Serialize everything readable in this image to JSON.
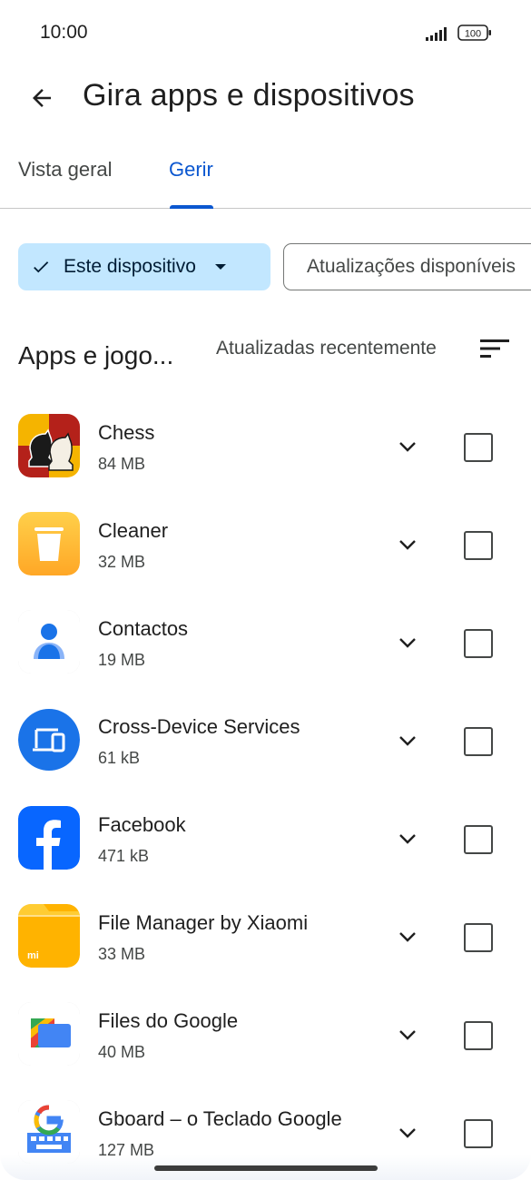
{
  "status_bar": {
    "time": "10:00",
    "battery": "100"
  },
  "header": {
    "back_icon": "arrow-back-icon",
    "title": "Gira apps e dispositivos"
  },
  "tabs": [
    {
      "label": "Vista geral",
      "selected": false
    },
    {
      "label": "Gerir",
      "selected": true
    }
  ],
  "filters": {
    "device_chip": {
      "label": "Este dispositivo",
      "selected": true,
      "icon": "check-icon"
    },
    "updates_chip": {
      "label": "Atualizações disponíveis"
    }
  },
  "list_header": {
    "title": "Apps e jogo...",
    "sort_label": "Atualizadas recentemente",
    "sort_icon": "sort-icon"
  },
  "apps": [
    {
      "name": "Chess",
      "size": "84 MB",
      "icon": "chess-icon"
    },
    {
      "name": "Cleaner",
      "size": "32 MB",
      "icon": "trash-icon"
    },
    {
      "name": "Contactos",
      "size": "19 MB",
      "icon": "person-icon"
    },
    {
      "name": "Cross-Device Services",
      "size": "61 kB",
      "icon": "devices-icon"
    },
    {
      "name": "Facebook",
      "size": "471 kB",
      "icon": "facebook-icon"
    },
    {
      "name": "File Manager by Xiaomi",
      "size": "33 MB",
      "icon": "folder-icon"
    },
    {
      "name": "Files do Google",
      "size": "40 MB",
      "icon": "files-icon"
    },
    {
      "name": "Gboard – o Teclado Google",
      "size": "127 MB",
      "icon": "keyboard-icon"
    }
  ],
  "colors": {
    "accent": "#0b57d0",
    "chip_selected_bg": "#c2e7ff"
  }
}
